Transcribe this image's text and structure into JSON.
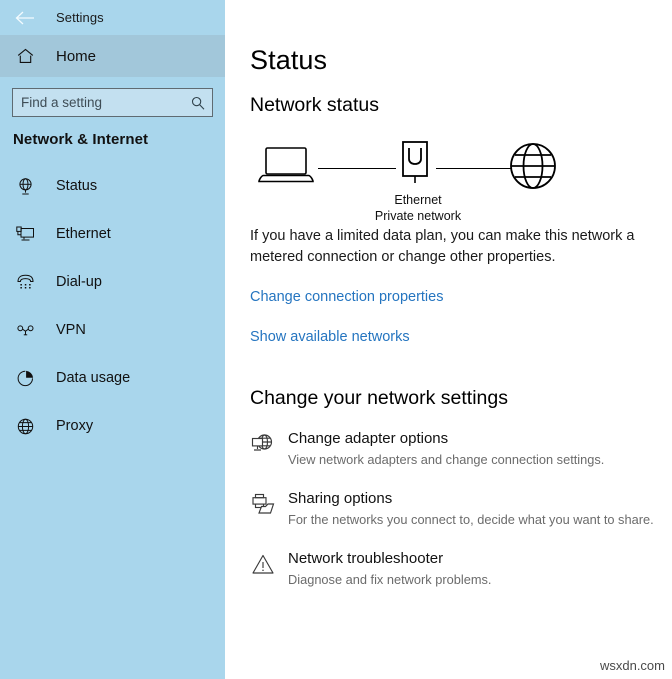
{
  "window": {
    "title": "Settings",
    "back_icon": "back-arrow-icon"
  },
  "sidebar": {
    "home": {
      "label": "Home",
      "icon": "home-icon"
    },
    "search": {
      "value": "",
      "placeholder": "Find a setting",
      "icon": "search-icon"
    },
    "category": "Network & Internet",
    "items": [
      {
        "label": "Status",
        "icon": "globe-stand-icon",
        "selected": true
      },
      {
        "label": "Ethernet",
        "icon": "ethernet-icon",
        "selected": false
      },
      {
        "label": "Dial-up",
        "icon": "telephone-icon",
        "selected": false
      },
      {
        "label": "VPN",
        "icon": "vpn-key-icon",
        "selected": false
      },
      {
        "label": "Data usage",
        "icon": "pie-chart-icon",
        "selected": false
      },
      {
        "label": "Proxy",
        "icon": "globe-icon",
        "selected": false
      }
    ]
  },
  "main": {
    "page_title": "Status",
    "network_status_heading": "Network status",
    "diagram": {
      "device_icon": "laptop-icon",
      "adapter_icon": "ethernet-port-icon",
      "internet_icon": "globe-icon",
      "adapter_name": "Ethernet",
      "network_type": "Private network"
    },
    "description": "If you have a limited data plan, you can make this network a metered connection or change other properties.",
    "links": [
      "Change connection properties",
      "Show available networks"
    ],
    "settings_heading": "Change your network settings",
    "options": [
      {
        "title": "Change adapter options",
        "desc": "View network adapters and change connection settings.",
        "icon": "adapter-globe-icon"
      },
      {
        "title": "Sharing options",
        "desc": "For the networks you connect to, decide what you want to share.",
        "icon": "printer-folder-icon"
      },
      {
        "title": "Network troubleshooter",
        "desc": "Diagnose and fix network problems.",
        "icon": "warning-triangle-icon"
      }
    ]
  },
  "watermark": "wsxdn.com",
  "colors": {
    "sidebar_bg": "#a9d6ec",
    "home_highlight": "#a2c7da",
    "link": "#2575c0",
    "desc_text": "#6b6b6b"
  }
}
